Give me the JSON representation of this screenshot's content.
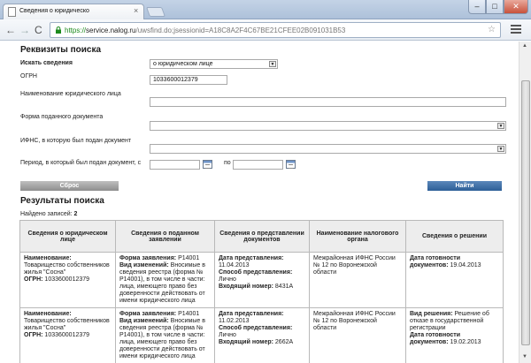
{
  "browser": {
    "tab_title": "Сведения о юридическо",
    "tab_close": "×",
    "window_min": "–",
    "window_max": "□",
    "window_close": "✕",
    "back_icon": "←",
    "forward_icon": "→",
    "reload_icon": "C",
    "url_scheme": "https://",
    "url_host": "service.nalog.ru",
    "url_path": "/uwsfind.do;jsessionid=A18C8A2F4C67BE21CFEE02B091031B53",
    "star_icon": "☆"
  },
  "search": {
    "title": "Реквизиты поиска",
    "search_for_label": "Искать сведения",
    "search_for_value": "о юридическом лице",
    "ogrn_label": "ОГРН",
    "ogrn_value": "1033600012379",
    "name_label": "Наименование юридического лица",
    "name_value": "",
    "form_label": "Форма поданного документа",
    "form_value": "",
    "ifns_label": "ИФНС, в которую был подан документ",
    "ifns_value": "",
    "period_label": "Период, в который был подан документ, с",
    "period_from_value": "",
    "period_to_label": "по",
    "period_to_value": "",
    "reset_button": "Сброс",
    "find_button": "Найти"
  },
  "results": {
    "title": "Результаты поиска",
    "found_label": "Найдено записей:",
    "found_count": "2",
    "columns": [
      "Сведения о юридическом лице",
      "Сведения о поданном заявлении",
      "Сведения о представлении документов",
      "Наименование налогового органа",
      "Сведения о решении"
    ],
    "rows": [
      {
        "name_label": "Наименование:",
        "name_value": "Товарищество собственников жилья \"Сосна\"",
        "ogrn_label": "ОГРН:",
        "ogrn_value": "1033600012379",
        "form_label": "Форма заявления:",
        "form_value": "Р14001",
        "change_label": "Вид изменений:",
        "change_value": "Вносимые в сведения реестра (форма № Р14001), в том числе в части: лица, имеющего право без доверенности действовать от имени юридического лица",
        "date_label": "Дата представления:",
        "date_value": "11.04.2013",
        "method_label": "Способ представления:",
        "method_value": "Лично",
        "incoming_label": "Входящий номер:",
        "incoming_value": "8431А",
        "authority": "Межрайонная ИФНС России № 12 по Воронежской области",
        "decision_kind_label": "",
        "decision_kind_value": "",
        "ready_label": "Дата готовности документов:",
        "ready_value": "19.04.2013"
      },
      {
        "name_label": "Наименование:",
        "name_value": "Товарищество собственников жилья \"Сосна\"",
        "ogrn_label": "ОГРН:",
        "ogrn_value": "1033600012379",
        "form_label": "Форма заявления:",
        "form_value": "Р14001",
        "change_label": "Вид изменений:",
        "change_value": "Вносимые в сведения реестра (форма № Р14001), в том числе в части: лица, имеющего право без доверенности действовать от имени юридического лица",
        "date_label": "Дата представления:",
        "date_value": "11.02.2013",
        "method_label": "Способ представления:",
        "method_value": "Лично",
        "incoming_label": "Входящий номер:",
        "incoming_value": "2662А",
        "authority": "Межрайонная ИФНС России № 12 по Воронежской области",
        "decision_kind_label": "Вид решения:",
        "decision_kind_value": "Решение об отказе в государственной регистрации",
        "ready_label": "Дата готовности документов:",
        "ready_value": "19.02.2013"
      }
    ]
  }
}
